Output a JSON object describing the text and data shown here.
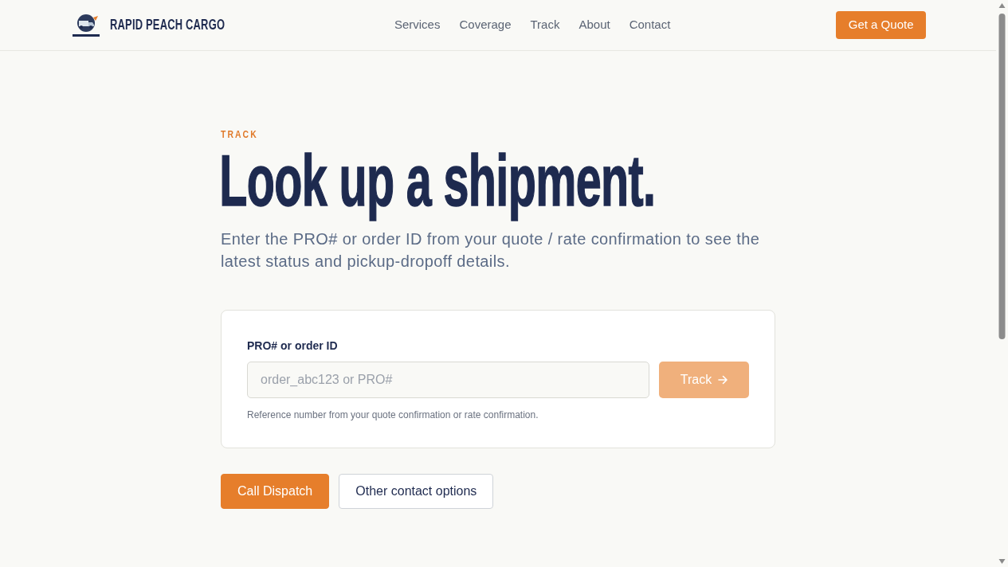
{
  "navbar": {
    "brand": "RAPID PEACH CARGO",
    "links": [
      {
        "label": "Services"
      },
      {
        "label": "Coverage"
      },
      {
        "label": "Track"
      },
      {
        "label": "About"
      },
      {
        "label": "Contact"
      }
    ],
    "cta": "Get a Quote"
  },
  "hero": {
    "eyebrow": "TRACK",
    "title": "Look up a shipment.",
    "lead": "Enter the PRO# or order ID from your quote / rate confirmation to see the latest status and pickup-dropoff details."
  },
  "track_form": {
    "label": "PRO# or order ID",
    "placeholder": "order_abc123 or PRO#",
    "submit": {
      "label": "Track",
      "disabled": true
    },
    "help": "Reference number from your quote confirmation or rate confirmation."
  },
  "actions": [
    {
      "label": "Call Dispatch",
      "kind": "primary"
    },
    {
      "label": "Other contact options",
      "kind": "outline"
    }
  ]
}
